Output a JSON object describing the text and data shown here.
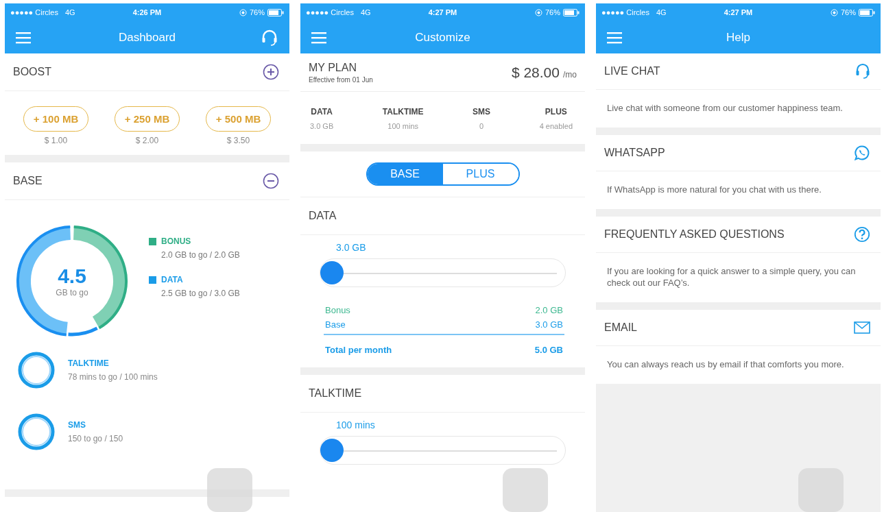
{
  "screens": [
    {
      "kind": "dashboard",
      "status": {
        "carrier": "●●●●● Circles",
        "network": "4G",
        "time": "4:26 PM",
        "battery": "76%"
      },
      "title": "Dashboard",
      "header_support": true,
      "boost": {
        "title": "BOOST",
        "expanded": false,
        "options": [
          {
            "label": "+ 100 MB",
            "price": "$ 1.00"
          },
          {
            "label": "+ 250 MB",
            "price": "$ 2.00"
          },
          {
            "label": "+ 500 MB",
            "price": "$ 3.50"
          }
        ]
      },
      "base": {
        "title": "BASE",
        "expanded": true,
        "total": "4.5",
        "unit": "GB to go",
        "legend": [
          {
            "name": "BONUS",
            "detail": "2.0 GB to go / 2.0 GB",
            "color": "#2fae86"
          },
          {
            "name": "DATA",
            "detail": "2.5 GB to go / 3.0 GB",
            "color": "#1a9ce8"
          }
        ],
        "rings": [
          {
            "name": "TALKTIME",
            "detail": "78 mins to go / 100 mins"
          },
          {
            "name": "SMS",
            "detail": "150 to go / 150"
          }
        ]
      }
    },
    {
      "kind": "customize",
      "status": {
        "carrier": "●●●●● Circles",
        "network": "4G",
        "time": "4:27 PM",
        "battery": "76%"
      },
      "title": "Customize",
      "header_support": false,
      "plan": {
        "title": "MY PLAN",
        "subtitle": "Effective from 01 Jun",
        "price": "$ 28.00",
        "period": "/mo"
      },
      "summary": [
        {
          "label": "DATA",
          "value": "3.0 GB"
        },
        {
          "label": "TALKTIME",
          "value": "100 mins"
        },
        {
          "label": "SMS",
          "value": "0"
        },
        {
          "label": "PLUS",
          "value": "4 enabled"
        }
      ],
      "segments": [
        {
          "label": "BASE",
          "selected": true
        },
        {
          "label": "PLUS",
          "selected": false
        }
      ],
      "sliders": [
        {
          "title": "DATA",
          "reading": "3.0 GB",
          "level": 0,
          "breakdown": [
            {
              "label": "Bonus",
              "value": "2.0 GB",
              "kind": "bonus"
            },
            {
              "label": "Base",
              "value": "3.0 GB",
              "kind": "base"
            }
          ],
          "total": {
            "label": "Total per month",
            "value": "5.0 GB"
          }
        },
        {
          "title": "TALKTIME",
          "reading": "100 mins",
          "level": 0
        }
      ]
    },
    {
      "kind": "help",
      "status": {
        "carrier": "●●●●● Circles",
        "network": "4G",
        "time": "4:27 PM",
        "battery": "76%"
      },
      "title": "Help",
      "header_support": false,
      "items": [
        {
          "title": "LIVE CHAT",
          "kind": "headset",
          "description": "Live chat with someone from our customer happiness team."
        },
        {
          "title": "WHATSAPP",
          "kind": "whatsapp",
          "description": "If WhatsApp is more natural for you chat with us there."
        },
        {
          "title": "FREQUENTLY ASKED QUESTIONS",
          "kind": "question",
          "description": "If you are looking for a quick answer to a simple query, you can check out our FAQ’s."
        },
        {
          "title": "EMAIL",
          "kind": "mail",
          "description": "You can always reach us by email if that comforts you more."
        }
      ]
    }
  ]
}
